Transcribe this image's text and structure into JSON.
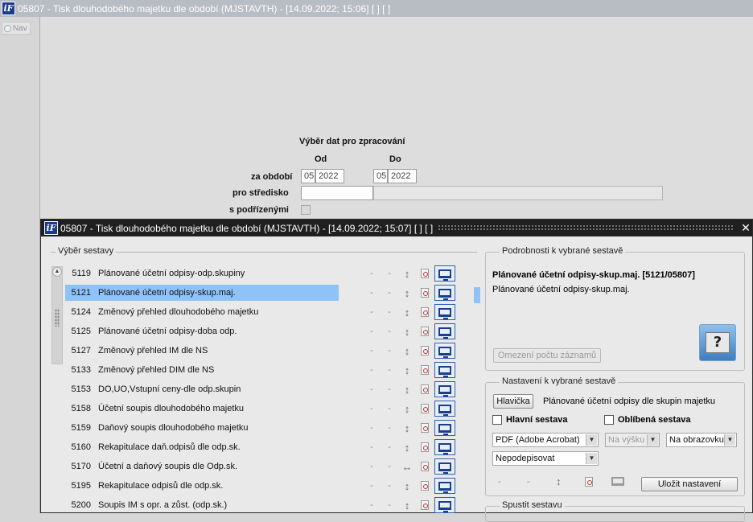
{
  "outer": {
    "logo": "iF",
    "title": "05807 - Tisk dlouhodobého majetku dle období (MJSTAVTH) - [14.09.2022; 15:06]  [ ]  [ ]",
    "nav_label": "Nav"
  },
  "form": {
    "section_title": "Výběr dat pro zpracování",
    "od_label": "Od",
    "do_label": "Do",
    "period_label": "za období",
    "from_month": "05",
    "from_year": "2022",
    "to_month": "05",
    "to_year": "2022",
    "center_label": "pro středisko",
    "center_value": "",
    "center_name": "",
    "sub_label": "s podřízenými"
  },
  "inner": {
    "logo": "iF",
    "title": "05807 - Tisk dlouhodobého majetku dle období (MJSTAVTH) - [14.09.2022; 15:07]  [ ]  [ ]",
    "close": "✕"
  },
  "reports": {
    "group_title": "Výběr sestavy",
    "selected_index": 1,
    "items": [
      {
        "code": "5119",
        "name": "Plánované účetní odpisy-odp.skupiny",
        "d1": "-",
        "d2": "-",
        "arrow": "↕"
      },
      {
        "code": "5121",
        "name": "Plánované účetní odpisy-skup.maj.",
        "d1": "-",
        "d2": "-",
        "arrow": "↕"
      },
      {
        "code": "5124",
        "name": "Změnový přehled dlouhodobého majetku",
        "d1": "-",
        "d2": "-",
        "arrow": "↕"
      },
      {
        "code": "5125",
        "name": "Plánované účetní odpisy-doba odp.",
        "d1": "-",
        "d2": "-",
        "arrow": "↕"
      },
      {
        "code": "5127",
        "name": "Změnový přehled IM dle NS",
        "d1": "-",
        "d2": "-",
        "arrow": "↕"
      },
      {
        "code": "5133",
        "name": "Změnový přehled DIM dle NS",
        "d1": "-",
        "d2": "-",
        "arrow": "↕"
      },
      {
        "code": "5153",
        "name": "DO,UO,Vstupní ceny-dle odp.skupin",
        "d1": "-",
        "d2": "-",
        "arrow": "↕"
      },
      {
        "code": "5158",
        "name": "Účetní soupis dlouhodobého majetku",
        "d1": "-",
        "d2": "-",
        "arrow": "↕"
      },
      {
        "code": "5159",
        "name": "Daňový soupis dlouhodobého majetku",
        "d1": "-",
        "d2": "-",
        "arrow": "↕"
      },
      {
        "code": "5160",
        "name": "Rekapitulace daň.odpisů dle odp.sk.",
        "d1": "-",
        "d2": "-",
        "arrow": "↕"
      },
      {
        "code": "5170",
        "name": "Účetní a daňový soupis dle Odp.sk.",
        "d1": "-",
        "d2": "-",
        "arrow": "↔"
      },
      {
        "code": "5195",
        "name": "Rekapitulace odpisů dle odp.sk.",
        "d1": "-",
        "d2": "-",
        "arrow": "↕"
      },
      {
        "code": "5200",
        "name": "Soupis IM s opr. a zůst. (odp.sk.)",
        "d1": "-",
        "d2": "-",
        "arrow": "↕"
      }
    ]
  },
  "details": {
    "group_title": "Podrobnosti k vybrané sestavě",
    "title": "Plánované účetní odpisy-skup.maj. [5121/05807]",
    "description": "Plánované účetní odpisy-skup.maj.",
    "limit_button": "Omezení počtu záznamů"
  },
  "settings": {
    "group_title": "Nastavení k vybrané sestavě",
    "header_button": "Hlavička",
    "header_text": "Plánované účetní odpisy dle skupin majetku",
    "main_label": "Hlavní sestava",
    "favorite_label": "Oblíbená sestava",
    "format": "PDF (Adobe Acrobat)",
    "orientation": "Na výšku",
    "output": "Na obrazovku",
    "signing": "Nepodepisovat",
    "d1": "-",
    "d2": "-",
    "arrow": "↕",
    "save_button": "Uložit nastavení"
  },
  "run": {
    "group_title": "Spustit sestavu"
  }
}
